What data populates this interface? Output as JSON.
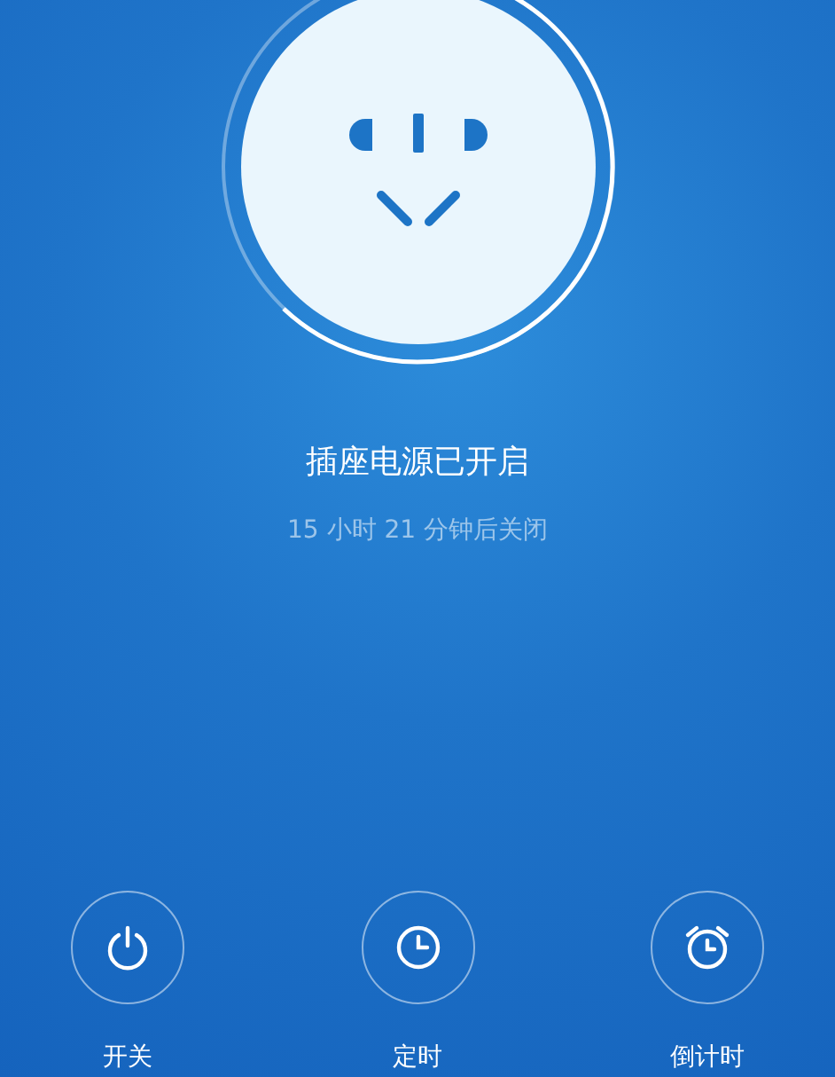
{
  "status": {
    "title": "插座电源已开启",
    "subtitle": "15 小时 21 分钟后关闭"
  },
  "actions": [
    {
      "kind": "power",
      "label": "开关"
    },
    {
      "kind": "timer",
      "label": "定时"
    },
    {
      "kind": "alarm",
      "label": "倒计时"
    }
  ]
}
